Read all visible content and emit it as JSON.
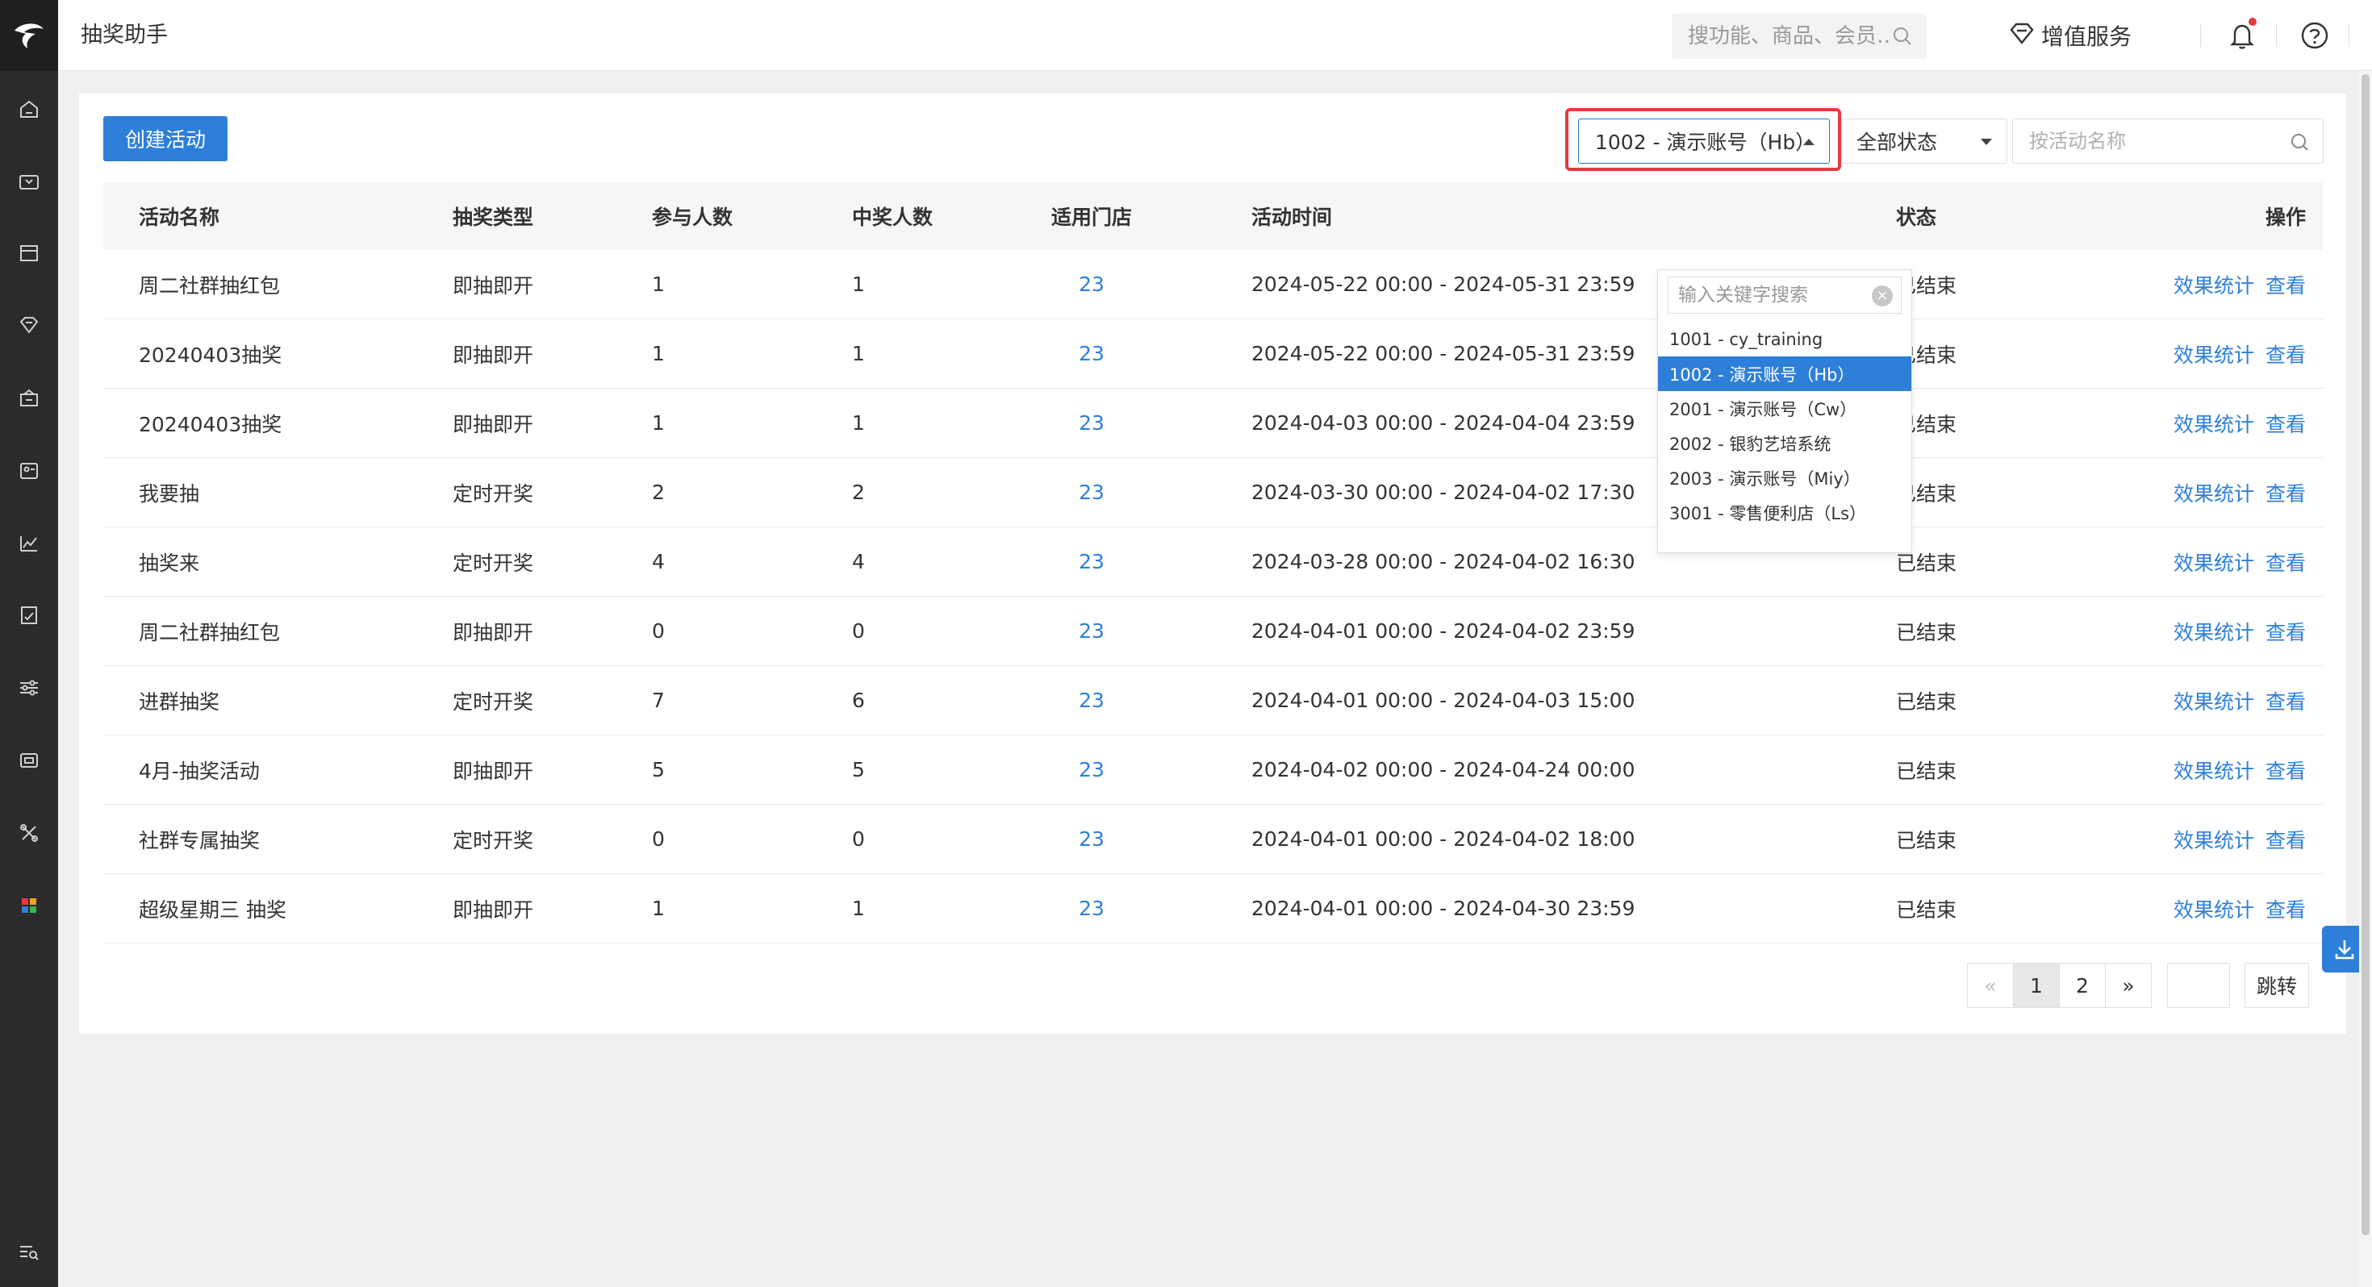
{
  "app": {
    "title": "抽奖助手"
  },
  "header": {
    "search_placeholder": "搜功能、商品、会员…",
    "value_added_label": "增值服务"
  },
  "sidebar": {
    "items": [
      "logo",
      "home-icon",
      "wallet-icon",
      "store-icon",
      "diamond-icon",
      "gift-icon",
      "member-card-icon",
      "chart-icon",
      "report-icon",
      "settings-sliders-icon",
      "coupon-icon",
      "tools-icon",
      "apps-icon",
      "menu-search-icon"
    ]
  },
  "toolbar": {
    "create_label": "创建活动",
    "store_selected": "1002 - 演示账号（Hb）",
    "status_selected": "全部状态",
    "name_search_placeholder": "按活动名称"
  },
  "dropdown": {
    "search_placeholder": "输入关键字搜索",
    "options": [
      "1001 - cy_training",
      "1002 - 演示账号（Hb）",
      "2001 - 演示账号（Cw）",
      "2002 - 银豹艺培系统",
      "2003 - 演示账号（Miy）",
      "3001 - 零售便利店（Ls）"
    ],
    "selected_index": 1
  },
  "table": {
    "columns": [
      "活动名称",
      "抽奖类型",
      "参与人数",
      "中奖人数",
      "适用门店",
      "活动时间",
      "状态",
      "操作"
    ],
    "rows": [
      {
        "name": "周二社群抽红包",
        "type": "即抽即开",
        "participants": "1",
        "winners": "1",
        "stores": "23",
        "time": "2024-05-22 00:00 - 2024-05-31 23:59",
        "status": "已结束"
      },
      {
        "name": "20240403抽奖",
        "type": "即抽即开",
        "participants": "1",
        "winners": "1",
        "stores": "23",
        "time": "2024-05-22 00:00 - 2024-05-31 23:59",
        "status": "已结束"
      },
      {
        "name": "20240403抽奖",
        "type": "即抽即开",
        "participants": "1",
        "winners": "1",
        "stores": "23",
        "time": "2024-04-03 00:00 - 2024-04-04 23:59",
        "status": "已结束"
      },
      {
        "name": "我要抽",
        "type": "定时开奖",
        "participants": "2",
        "winners": "2",
        "stores": "23",
        "time": "2024-03-30 00:00 - 2024-04-02 17:30",
        "status": "已结束"
      },
      {
        "name": "抽奖来",
        "type": "定时开奖",
        "participants": "4",
        "winners": "4",
        "stores": "23",
        "time": "2024-03-28 00:00 - 2024-04-02 16:30",
        "status": "已结束"
      },
      {
        "name": "周二社群抽红包",
        "type": "即抽即开",
        "participants": "0",
        "winners": "0",
        "stores": "23",
        "time": "2024-04-01 00:00 - 2024-04-02 23:59",
        "status": "已结束"
      },
      {
        "name": "进群抽奖",
        "type": "定时开奖",
        "participants": "7",
        "winners": "6",
        "stores": "23",
        "time": "2024-04-01 00:00 - 2024-04-03 15:00",
        "status": "已结束"
      },
      {
        "name": "4月-抽奖活动",
        "type": "即抽即开",
        "participants": "5",
        "winners": "5",
        "stores": "23",
        "time": "2024-04-02 00:00 - 2024-04-24 00:00",
        "status": "已结束"
      },
      {
        "name": "社群专属抽奖",
        "type": "定时开奖",
        "participants": "0",
        "winners": "0",
        "stores": "23",
        "time": "2024-04-01 00:00 - 2024-04-02 18:00",
        "status": "已结束"
      },
      {
        "name": "超级星期三 抽奖",
        "type": "即抽即开",
        "participants": "1",
        "winners": "1",
        "stores": "23",
        "time": "2024-04-01 00:00 - 2024-04-30 23:59",
        "status": "已结束"
      }
    ],
    "op_stats_label": "效果统计",
    "op_view_label": "查看"
  },
  "pagination": {
    "prev": "«",
    "pages": [
      "1",
      "2"
    ],
    "current": "1",
    "next": "»",
    "jump_label": "跳转"
  },
  "colors": {
    "accent": "#2e7fd9",
    "highlight": "#e5393f",
    "sidebar_bg": "#2b2b2b"
  }
}
